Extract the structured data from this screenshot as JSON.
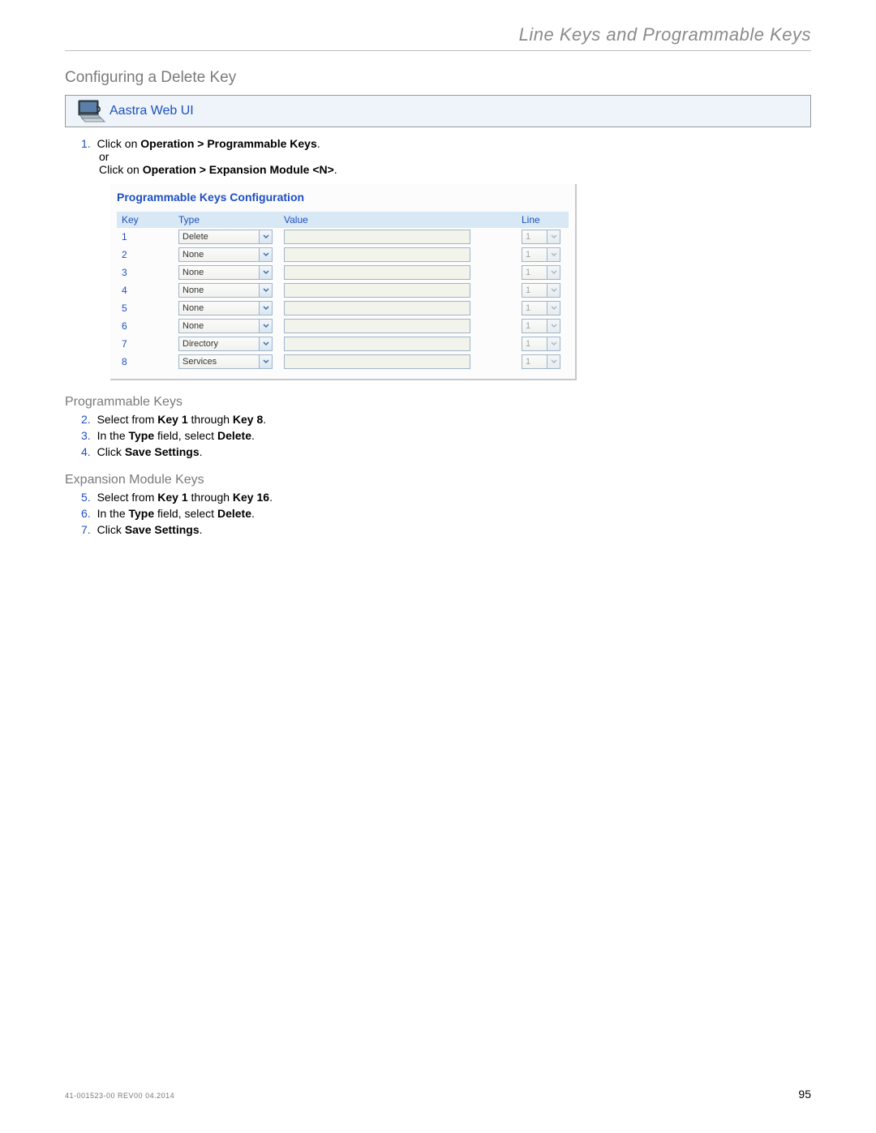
{
  "header": {
    "title": "Line Keys and Programmable Keys"
  },
  "section": {
    "title": "Configuring a Delete Key"
  },
  "callout": {
    "title": "Aastra Web UI"
  },
  "step1": {
    "num": "1.",
    "pre": "Click on ",
    "bold1": "Operation > Programmable Keys",
    "post1": ".",
    "or": "or",
    "pre2": "Click on ",
    "bold2": "Operation > Expansion Module <N>",
    "post2": "."
  },
  "config": {
    "title": "Programmable Keys Configuration",
    "headers": {
      "key": "Key",
      "type": "Type",
      "value": "Value",
      "line": "Line"
    },
    "rows": [
      {
        "key": "1",
        "type": "Delete",
        "value": "",
        "line": "1",
        "line_enabled": false
      },
      {
        "key": "2",
        "type": "None",
        "value": "",
        "line": "1",
        "line_enabled": false
      },
      {
        "key": "3",
        "type": "None",
        "value": "",
        "line": "1",
        "line_enabled": false
      },
      {
        "key": "4",
        "type": "None",
        "value": "",
        "line": "1",
        "line_enabled": false
      },
      {
        "key": "5",
        "type": "None",
        "value": "",
        "line": "1",
        "line_enabled": false
      },
      {
        "key": "6",
        "type": "None",
        "value": "",
        "line": "1",
        "line_enabled": false
      },
      {
        "key": "7",
        "type": "Directory",
        "value": "",
        "line": "1",
        "line_enabled": false
      },
      {
        "key": "8",
        "type": "Services",
        "value": "",
        "line": "1",
        "line_enabled": false
      }
    ]
  },
  "prog": {
    "title": "Programmable Keys",
    "s2": {
      "num": "2.",
      "a": "Select from ",
      "b1": "Key 1",
      "c": " through ",
      "b2": "Key 8",
      "d": "."
    },
    "s3": {
      "num": "3.",
      "a": "In the ",
      "b1": "Type",
      "c": " field, select ",
      "b2": "Delete",
      "d": "."
    },
    "s4": {
      "num": "4.",
      "a": "Click ",
      "b1": "Save Settings",
      "d": "."
    }
  },
  "exp": {
    "title": "Expansion Module Keys",
    "s5": {
      "num": "5.",
      "a": "Select from ",
      "b1": "Key 1",
      "c": " through ",
      "b2": "Key 16",
      "d": "."
    },
    "s6": {
      "num": "6.",
      "a": "In the ",
      "b1": "Type",
      "c": " field, select ",
      "b2": "Delete",
      "d": "."
    },
    "s7": {
      "num": "7.",
      "a": "Click ",
      "b1": "Save Settings",
      "d": "."
    }
  },
  "footer": {
    "doc_id": "41-001523-00 REV00  04.2014",
    "page": "95"
  }
}
